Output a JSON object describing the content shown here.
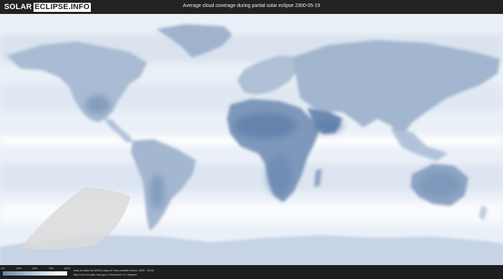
{
  "header": {
    "logo_part1": "SOLAR",
    "logo_part2": "ECLIPSE.INFO",
    "title": "Average cloud coverage during partial solar eclipse 2300-05-19"
  },
  "map": {
    "ocean_color": "#f2f6fb",
    "land_color": "#a7bad2",
    "dense_cloud_color": "#f9fbfd",
    "clear_sky_color": "#5e7ea8",
    "eclipse_area_color": "#dcdcdc"
  },
  "legend": {
    "ticks": [
      "0%",
      "25%",
      "50%",
      "75%",
      "100%"
    ]
  },
  "credits": {
    "line1": "Data provided by NASA's Aqua & Terra satellite (Years: 2000 - 2019)",
    "line2": "https://neo.sci.gsfc.nasa.gov | Resolution: 0.1 degrees"
  }
}
